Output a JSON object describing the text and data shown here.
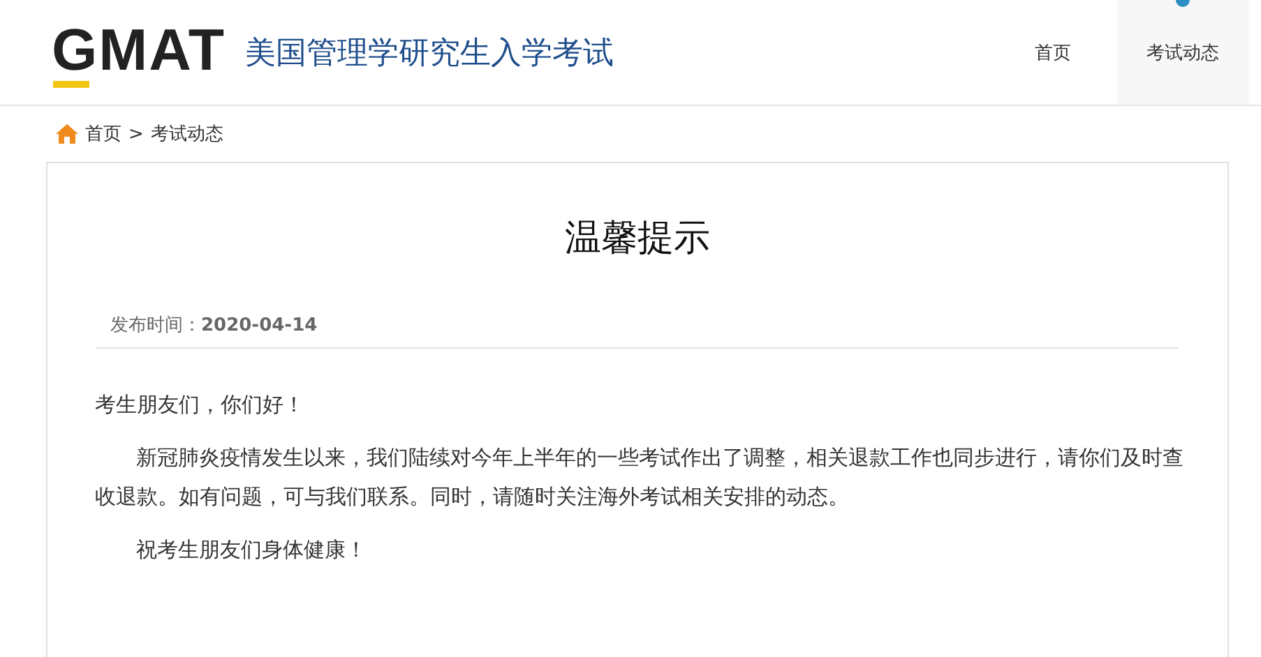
{
  "header": {
    "logo": "GMAT",
    "site_title": "美国管理学研究生入学考试"
  },
  "nav": [
    {
      "label": "首页",
      "selected": false
    },
    {
      "label": "考试动态",
      "selected": true
    }
  ],
  "breadcrumb": {
    "items": [
      "首页",
      "考试动态"
    ],
    "separator": ">"
  },
  "article": {
    "title": "温馨提示",
    "date_label": "发布时间：",
    "date": "2020-04-14",
    "paragraphs": [
      {
        "text": "考生朋友们，你们好！",
        "indent": false
      },
      {
        "text": "新冠肺炎疫情发生以来，我们陆续对今年上半年的一些考试作出了调整，相关退款工作也同步进行，请你们及时查收退款。如有问题，可与我们联系。同时，请随时关注海外考试相关安排的动态。",
        "indent": true
      },
      {
        "text": "祝考生朋友们身体健康！",
        "indent": true
      }
    ]
  }
}
